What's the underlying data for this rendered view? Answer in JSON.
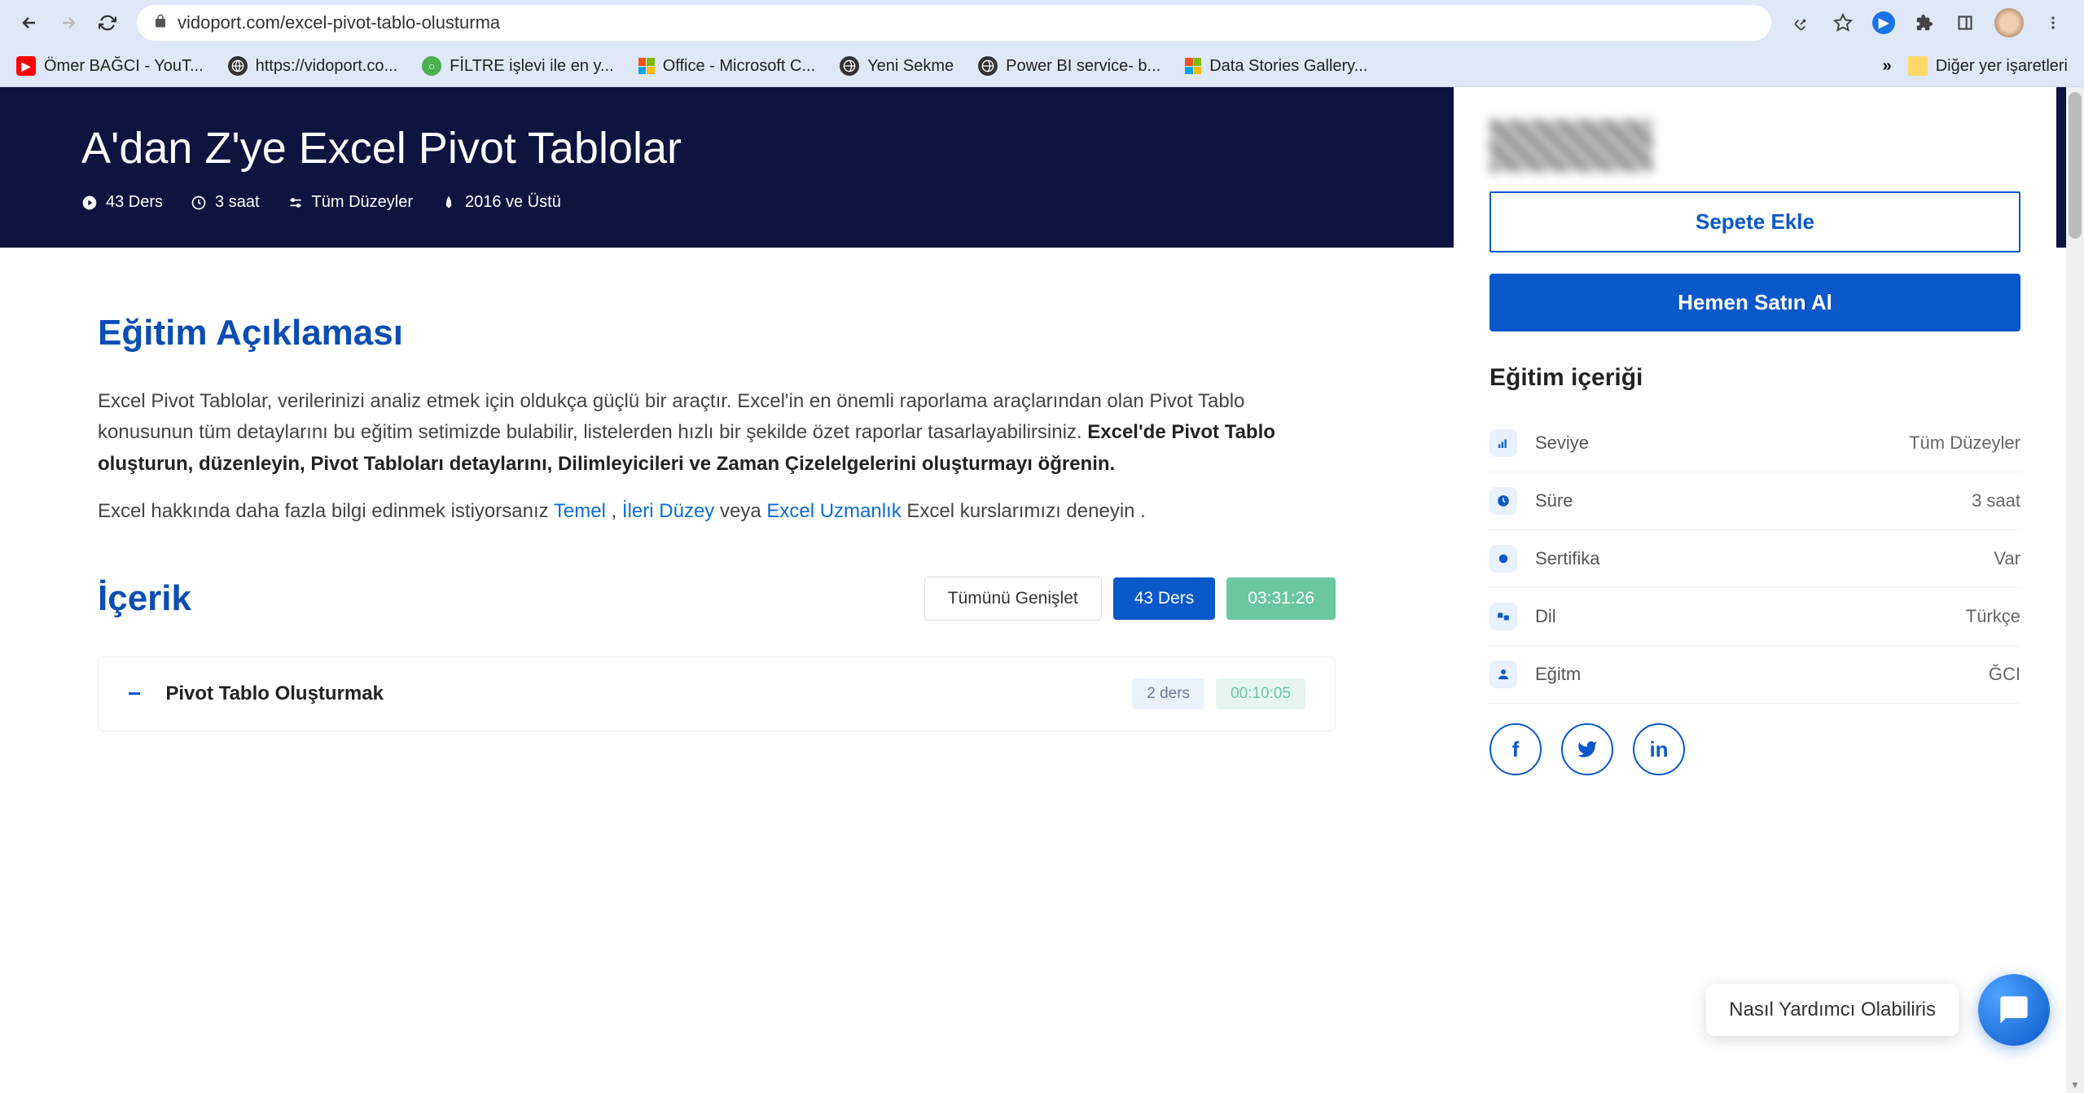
{
  "browser": {
    "url": "vidoport.com/excel-pivot-tablo-olusturma",
    "bookmarks": [
      {
        "label": "Ömer BAĞCI - YouT...",
        "icon": "youtube"
      },
      {
        "label": "https://vidoport.co...",
        "icon": "globe"
      },
      {
        "label": "FİLTRE işlevi ile en y...",
        "icon": "green"
      },
      {
        "label": "Office - Microsoft C...",
        "icon": "ms"
      },
      {
        "label": "Yeni Sekme",
        "icon": "globe"
      },
      {
        "label": "Power BI service- b...",
        "icon": "globe"
      },
      {
        "label": "Data Stories Gallery...",
        "icon": "ms"
      }
    ],
    "other_bookmarks": "Diğer yer işaretleri"
  },
  "hero": {
    "title": "A'dan Z'ye Excel Pivot Tablolar",
    "lessons": "43 Ders",
    "duration": "3 saat",
    "level": "Tüm Düzeyler",
    "version": "2016 ve Üstü"
  },
  "description": {
    "heading": "Eğitim Açıklaması",
    "p1a": "Excel Pivot Tablolar, verilerinizi analiz etmek için oldukça güçlü bir araçtır. Excel'in en önemli raporlama araçlarından olan Pivot Tablo konusunun tüm detaylarını bu eğitim setimizde bulabilir, listelerden hızlı bir şekilde özet raporlar tasarlayabilirsiniz. ",
    "p1b": "Excel'de Pivot Tablo oluşturun, düzenleyin, Pivot Tabloları detaylarını, Dilimleyicileri ve Zaman Çizelelgelerini oluşturmayı öğrenin.",
    "p2a": "Excel hakkında daha fazla bilgi edinmek istiyorsanız ",
    "link1": "Temel",
    "p2b": " , ",
    "link2": "İleri Düzey",
    "p2c": " veya ",
    "link3": "Excel Uzmanlık",
    "p2d": " Excel kurslarımızı deneyin ."
  },
  "content": {
    "heading": "İçerik",
    "expand_all": "Tümünü Genişlet",
    "lessons_badge": "43 Ders",
    "duration_badge": "03:31:26",
    "items": [
      {
        "title": "Pivot Tablo Oluşturmak",
        "count": "2 ders",
        "time": "00:10:05"
      }
    ]
  },
  "sidebar": {
    "add_cart": "Sepete Ekle",
    "buy_now": "Hemen Satın Al",
    "content_heading": "Eğitim içeriği",
    "rows": [
      {
        "label": "Seviye",
        "value": "Tüm Düzeyler",
        "icon": "level"
      },
      {
        "label": "Süre",
        "value": "3 saat",
        "icon": "clock"
      },
      {
        "label": "Sertifika",
        "value": "Var",
        "icon": "cert"
      },
      {
        "label": "Dil",
        "value": "Türkçe",
        "icon": "lang"
      },
      {
        "label": "Eğitm",
        "value": "ĞCI",
        "icon": "user"
      }
    ]
  },
  "chat": {
    "text": "Nasıl Yardımcı Olabiliris"
  }
}
